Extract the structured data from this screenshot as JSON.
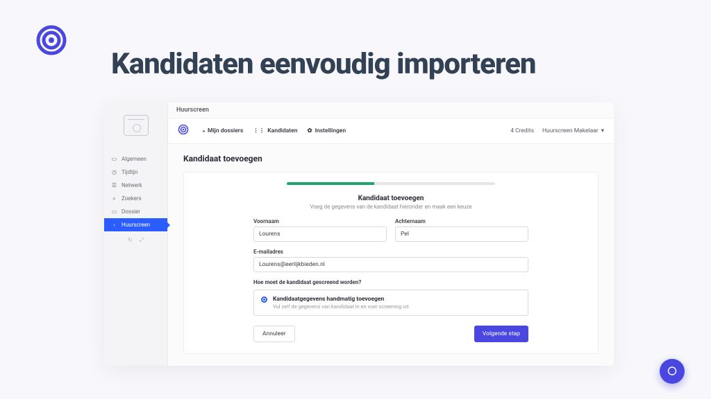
{
  "page": {
    "title": "Kandidaten eenvoudig importeren"
  },
  "sidebar": {
    "items": [
      {
        "icon": "folder",
        "label": "Algemeen"
      },
      {
        "icon": "clock",
        "label": "Tijdlijn"
      },
      {
        "icon": "eye",
        "label": "Netwerk"
      },
      {
        "icon": "search",
        "label": "Zoekers"
      },
      {
        "icon": "calendar",
        "label": "Dossier"
      },
      {
        "icon": "chevron",
        "label": "Huurscreen"
      }
    ],
    "active_index": 5
  },
  "crumb": "Huurscreen",
  "topbar": {
    "nav": [
      {
        "icon": "folder-solid",
        "label": "Mijn dossiers"
      },
      {
        "icon": "users",
        "label": "Kandidaten"
      },
      {
        "icon": "gear",
        "label": "Instellingen"
      }
    ],
    "credits": "4 Credits",
    "user": "Huurscreen Makelaar"
  },
  "content": {
    "title": "Kandidaat toevoegen",
    "step_title": "Kandidaat toevoegen",
    "step_sub": "Voeg de gegevens van de kandidaat hieronder en maak een keuze",
    "fields": {
      "voornaam_label": "Voornaam",
      "voornaam_value": "Lourens",
      "achternaam_label": "Achternaam",
      "achternaam_value": "Pel",
      "email_label": "E-mailadres",
      "email_value": "Lourens@eerlijkbieden.nl"
    },
    "question": "Hoe moet de kandidaat gescreend worden?",
    "option": {
      "title": "Kandidaatgegevens handmatig toevoegen",
      "sub": "Vul zelf de gegevens van kandidaat in en voer screening uit"
    },
    "buttons": {
      "cancel": "Annuleer",
      "next": "Volgende stap"
    }
  }
}
